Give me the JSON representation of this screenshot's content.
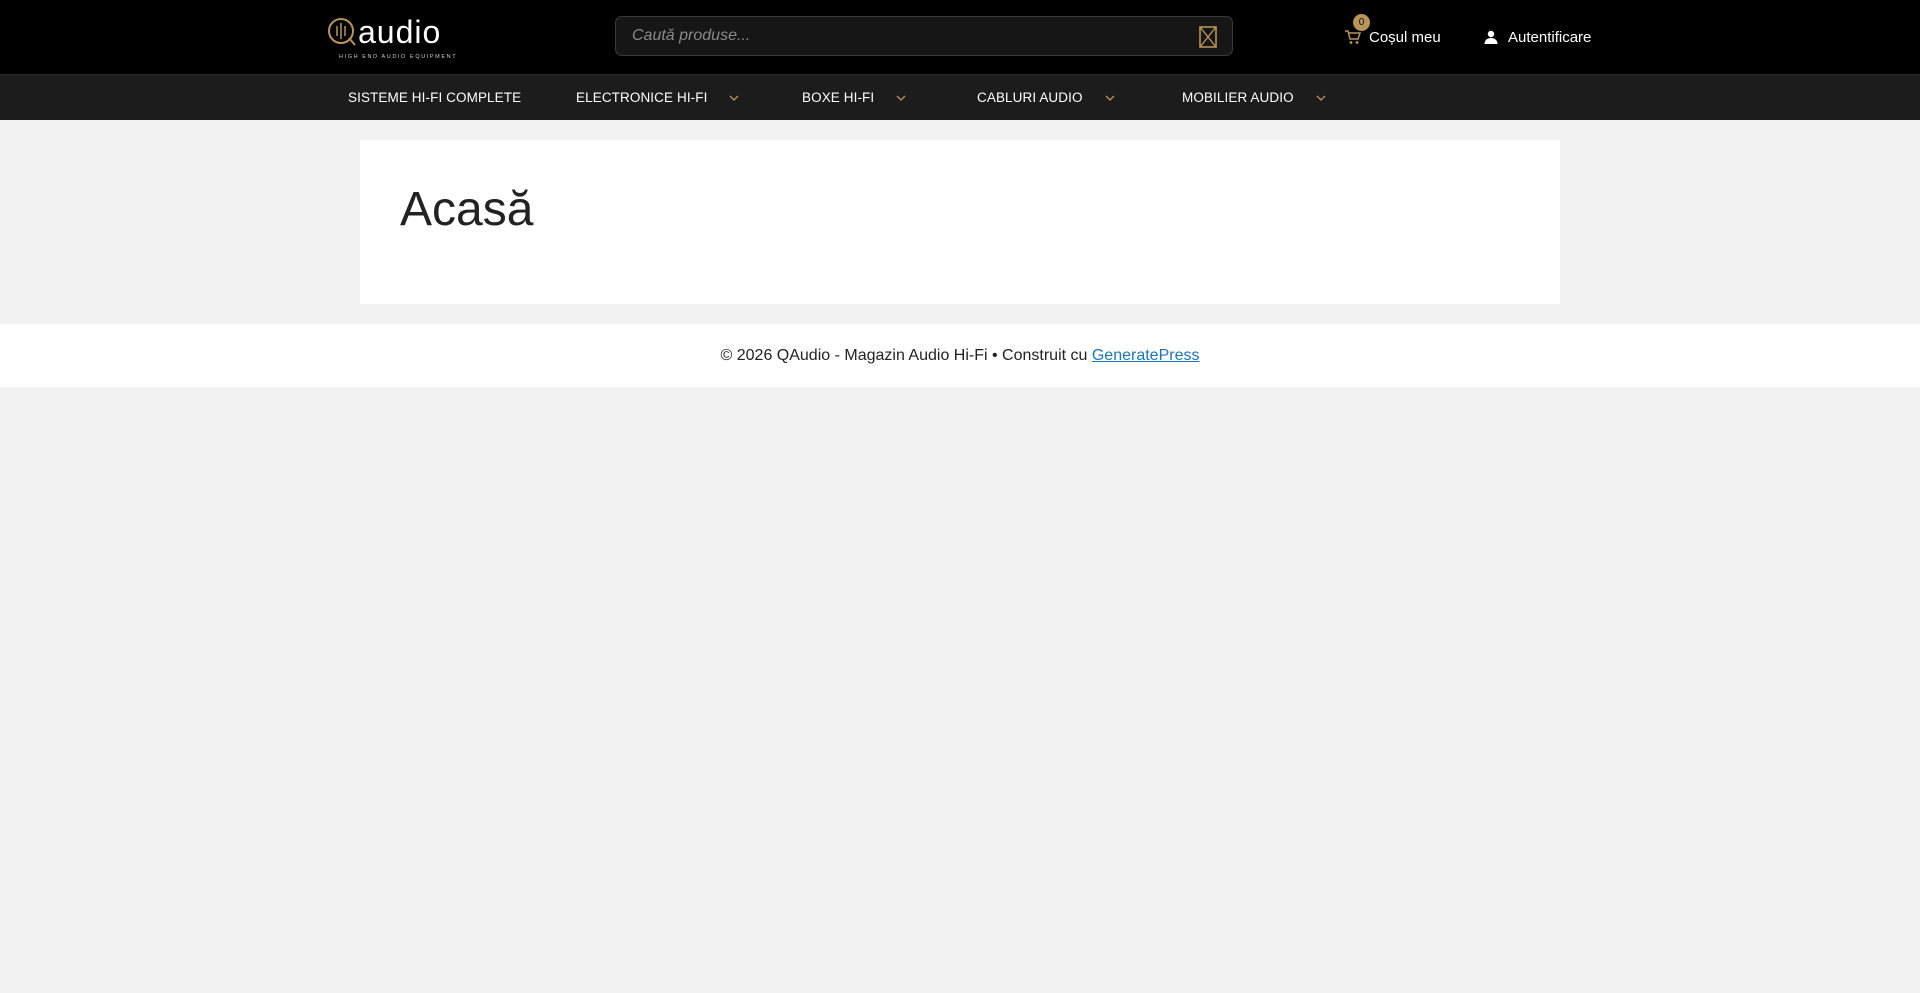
{
  "header": {
    "logo_text": "Qaudio",
    "logo_tagline": "HIGH END AUDIO EQUIPMENT",
    "search": {
      "placeholder": "Caută produse..."
    },
    "cart": {
      "label": "Coșul meu",
      "count": "0"
    },
    "login_label": "Autentificare"
  },
  "nav": {
    "items": [
      {
        "label": "SISTEME HI-FI COMPLETE",
        "has_dropdown": false
      },
      {
        "label": "ELECTRONICE HI-FI",
        "has_dropdown": true
      },
      {
        "label": "BOXE HI-FI",
        "has_dropdown": true
      },
      {
        "label": "CABLURI AUDIO",
        "has_dropdown": true
      },
      {
        "label": "MOBILIER AUDIO",
        "has_dropdown": true
      }
    ]
  },
  "main": {
    "title": "Acasă"
  },
  "footer": {
    "text": "© 2026 QAudio - Magazin Audio Hi-Fi • Construit cu ",
    "link": "GeneratePress"
  },
  "colors": {
    "topbar": "#000000",
    "navbar": "#1c1c1c",
    "accent_gold": "#b89458",
    "page_bg": "#f2f2f2",
    "link": "#1e73be"
  },
  "icons": [
    "logo-icon",
    "search-icon",
    "cart-icon",
    "user-icon",
    "chevron-down-icon"
  ]
}
